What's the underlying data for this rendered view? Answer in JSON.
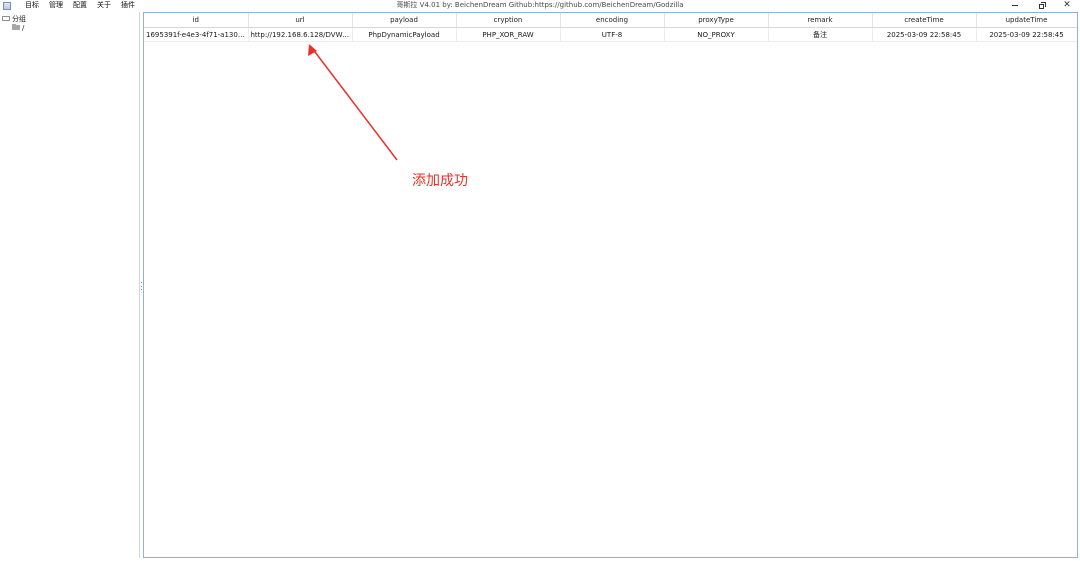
{
  "window": {
    "title": "哥斯拉  V4.01 by: BeichenDream Github:https://github.com/BeichenDream/Godzilla",
    "menu": [
      "目标",
      "管理",
      "配置",
      "关于",
      "插件"
    ]
  },
  "tree": {
    "root_label": "分组",
    "child_label": "/"
  },
  "table": {
    "columns": [
      "id",
      "url",
      "payload",
      "cryption",
      "encoding",
      "proxyType",
      "remark",
      "createTime",
      "updateTime"
    ],
    "rows": [
      {
        "id": "1695391f-e4e3-4f71-a130-0b...",
        "url": "http://192.168.6.128/DVWA-...",
        "payload": "PhpDynamicPayload",
        "cryption": "PHP_XOR_RAW",
        "encoding": "UTF-8",
        "proxyType": "NO_PROXY",
        "remark": "备注",
        "createTime": "2025-03-09 22:58:45",
        "updateTime": "2025-03-09 22:58:45"
      }
    ]
  },
  "annotation": {
    "text": "添加成功",
    "color": "#e8322a"
  },
  "colors": {
    "panel_border": "#8fb0e0",
    "annotation": "#e8322a"
  }
}
